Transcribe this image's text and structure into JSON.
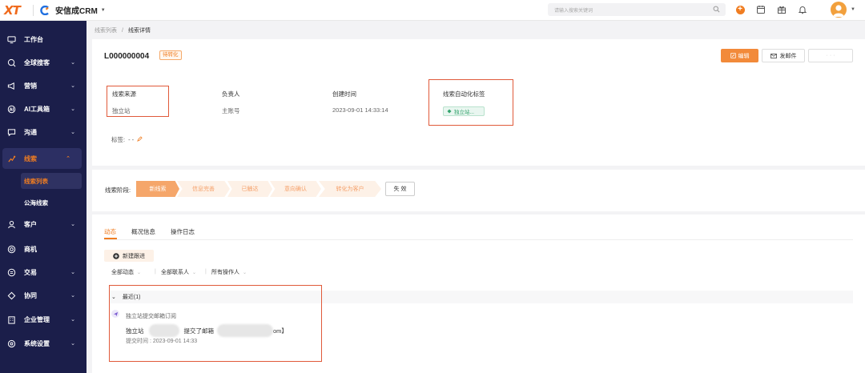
{
  "brand": {
    "logo_text": "XT",
    "name": "安信成CRM"
  },
  "search": {
    "placeholder": "请输入搜索关键词"
  },
  "sidebar": {
    "items": [
      {
        "label": "工作台",
        "icon": "monitor-icon",
        "expandable": false
      },
      {
        "label": "全球搜客",
        "icon": "globe-search-icon",
        "expandable": true
      },
      {
        "label": "营销",
        "icon": "megaphone-icon",
        "expandable": true
      },
      {
        "label": "AI工具箱",
        "icon": "ai-toolbox-icon",
        "expandable": true
      },
      {
        "label": "沟通",
        "icon": "chat-icon",
        "expandable": true
      },
      {
        "label": "线索",
        "icon": "leads-icon",
        "expandable": true,
        "expanded": true
      },
      {
        "label": "客户",
        "icon": "customer-icon",
        "expandable": true
      },
      {
        "label": "商机",
        "icon": "opportunity-icon",
        "expandable": false
      },
      {
        "label": "交易",
        "icon": "transaction-icon",
        "expandable": true
      },
      {
        "label": "协同",
        "icon": "collaboration-icon",
        "expandable": true
      },
      {
        "label": "企业管理",
        "icon": "enterprise-icon",
        "expandable": true
      },
      {
        "label": "系统设置",
        "icon": "settings-icon",
        "expandable": true
      }
    ],
    "sub_items": [
      {
        "label": "线索列表",
        "active": true
      },
      {
        "label": "公海线索",
        "active": false
      }
    ]
  },
  "breadcrumb": {
    "parent": "线索列表",
    "separator": "/",
    "current": "线索详情"
  },
  "lead": {
    "id": "L000000004",
    "status_badge": "待转化",
    "actions": {
      "edit": "编辑",
      "send_mail": "发邮件",
      "more": "· · ·"
    },
    "fields": {
      "source_label": "线索来源",
      "source_value": "独立站",
      "owner_label": "负责人",
      "owner_value": "主账号",
      "created_label": "创建时间",
      "created_value": "2023-09-01 14:33:14",
      "auto_tag_label": "线索自动化标签",
      "auto_tag_value": "独立站..."
    },
    "tags_label": "标签:",
    "tags_value": "- -"
  },
  "stages": {
    "label": "线索阶段:",
    "items": [
      "新线索",
      "信息完善",
      "已触达",
      "意向确认",
      "转化为客户"
    ],
    "current_index": 0,
    "fail_button": "失 效"
  },
  "activity": {
    "tabs": [
      "动态",
      "概况信息",
      "操作日志"
    ],
    "active_tab": 0,
    "new_follow_button": "新建跟进",
    "filters": [
      "全部动态",
      "全部联系人",
      "所有操作人"
    ],
    "group_title": "最近(1)",
    "entry": {
      "title": "独立站提交邮箱订阅",
      "prefix": "独立站",
      "middle": "提交了邮箱",
      "suffix": "om】",
      "time_label": "提交时间",
      "time_value": "2023-09-01 14:33"
    }
  },
  "colors": {
    "accent": "#f07d21",
    "sidebar_bg": "#1b1e4a",
    "highlight_border": "#e05a3a",
    "tag_green": "#34a36d"
  }
}
